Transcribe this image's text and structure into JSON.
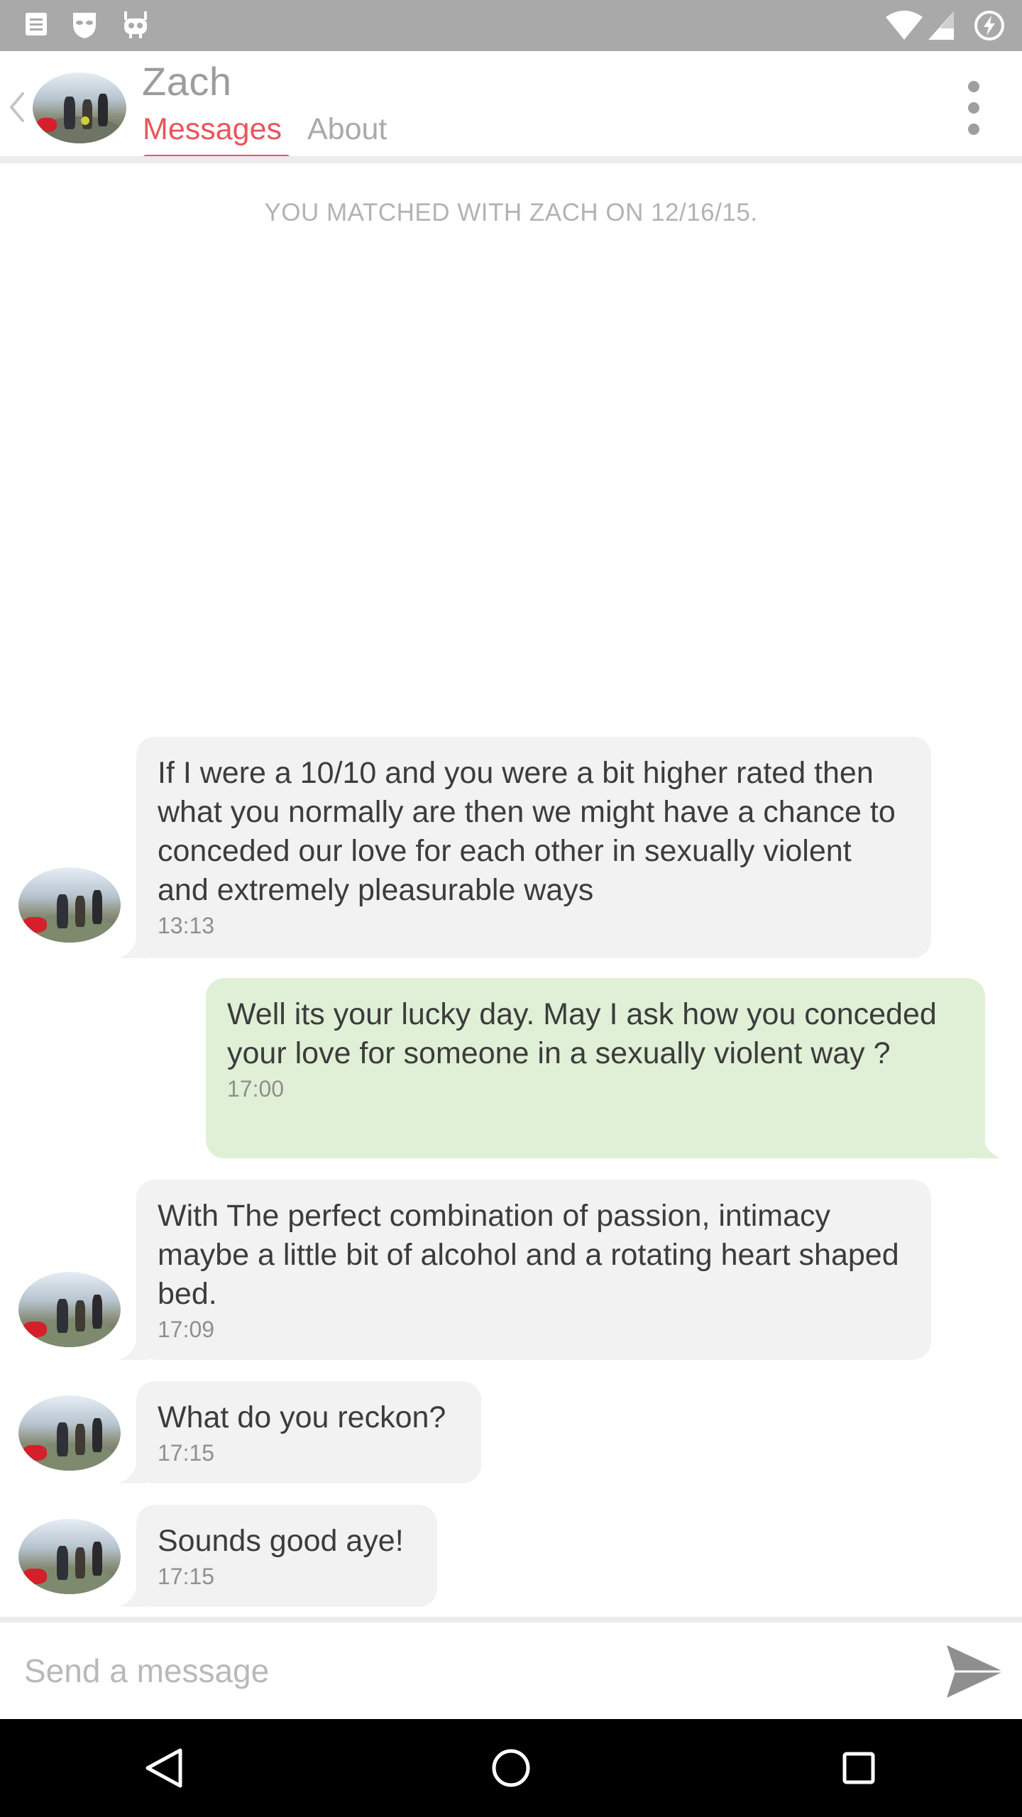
{
  "status_bar": {
    "left_icons": [
      "notes-icon",
      "mask-icon",
      "android-icon"
    ],
    "right_icons": [
      "wifi-icon",
      "cell-signal-icon",
      "battery-charging-icon"
    ]
  },
  "header": {
    "contact_name": "Zach",
    "tabs": [
      {
        "label": "Messages",
        "active": true
      },
      {
        "label": "About",
        "active": false
      }
    ],
    "accent_color": "#e9555d"
  },
  "matched_text": "YOU MATCHED WITH ZACH ON 12/16/15.",
  "messages": [
    {
      "direction": "incoming",
      "text": "If I were a 10/10 and you were a bit higher rated then what you normally are then we might have a chance to conceded our love for each other in sexually violent and extremely pleasurable ways",
      "time": "13:13"
    },
    {
      "direction": "outgoing",
      "text": "Well its your lucky day. May I ask how you conceded your love for someone in a sexually violent way ?",
      "time": "17:00"
    },
    {
      "direction": "incoming",
      "text": "With The perfect combination of passion, intimacy maybe a little bit of alcohol and a rotating heart shaped bed.",
      "time": "17:09"
    },
    {
      "direction": "incoming",
      "text": "What do you reckon?",
      "time": "17:15"
    },
    {
      "direction": "incoming",
      "text": "Sounds good aye!",
      "time": "17:15"
    }
  ],
  "compose": {
    "placeholder": "Send a message",
    "value": ""
  },
  "colors": {
    "incoming_bubble": "#f2f2f2",
    "outgoing_bubble": "#dff0d6",
    "status_bar": "#a9a9a9",
    "nav_bar": "#000000"
  }
}
